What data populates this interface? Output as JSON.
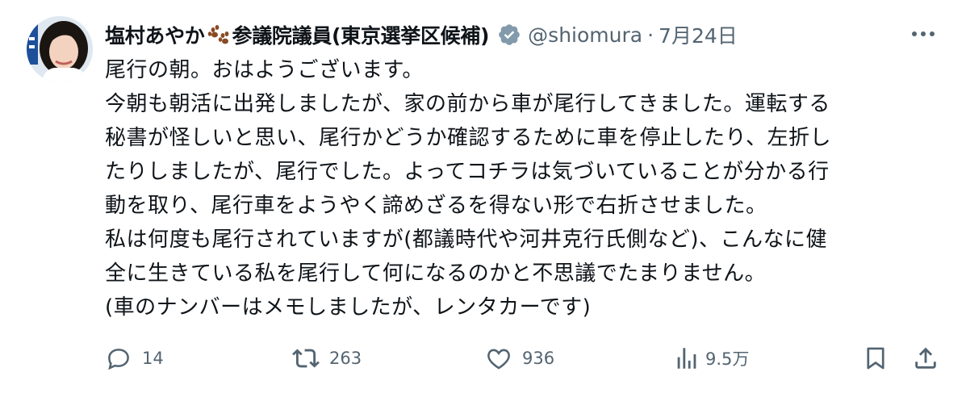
{
  "author": {
    "display_name": "塩村あやか",
    "title_suffix": "参議院議員(東京選挙区候補)",
    "handle": "@shiomura",
    "separator": "·",
    "date": "7月24日",
    "avatar_icon": "profile-photo",
    "badge_icon": "verified-badge-icon",
    "emoji_icon": "paw-prints-icon",
    "badge_color": "#829aab"
  },
  "post": {
    "lines": [
      "尾行の朝。おはようございます。",
      "今朝も朝活に出発しましたが、家の前から車が尾行してきました。運転する",
      "秘書が怪しいと思い、尾行かどうか確認するために車を停止したり、左折し",
      "たりしましたが、尾行でした。よってコチラは気づいていることが分かる行",
      "動を取り、尾行車をようやく諦めざるを得ない形で右折させました。",
      "私は何度も尾行されていますが(都議時代や河井克行氏側など)、こんなに健",
      "全に生きている私を尾行して何になるのかと不思議でたまりません。",
      "(車のナンバーはメモしましたが、レンタカーです)"
    ]
  },
  "actions": {
    "replies": "14",
    "reposts": "263",
    "likes": "936",
    "views": "9.5万"
  },
  "icons": [
    "more-icon",
    "reply-icon",
    "repost-icon",
    "like-icon",
    "views-icon",
    "bookmark-icon",
    "share-icon"
  ],
  "colors": {
    "text": "#0f1419",
    "secondary": "#536471"
  }
}
